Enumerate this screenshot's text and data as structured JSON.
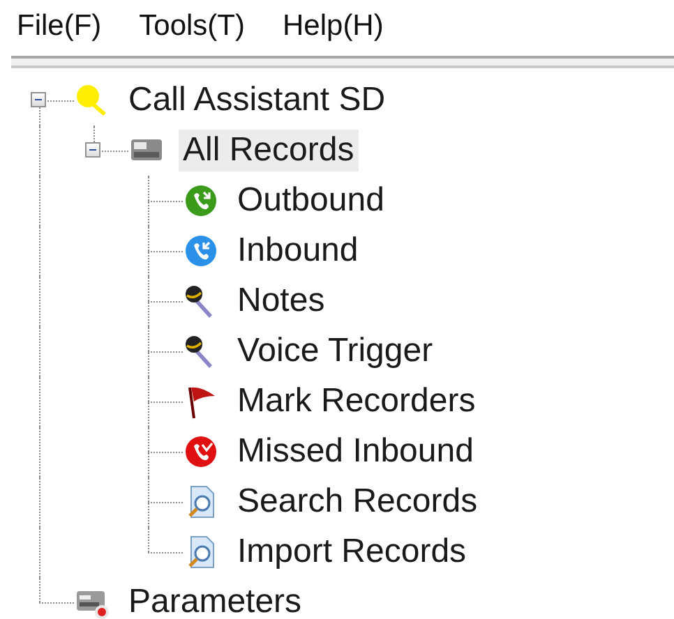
{
  "menu": [
    {
      "label": "File(F)"
    },
    {
      "label": "Tools(T)"
    },
    {
      "label": "Help(H)"
    }
  ],
  "tree": [
    {
      "label": "Call Assistant SD",
      "kind": "key",
      "expanded": true,
      "selected": false,
      "children": [
        {
          "label": "All Records",
          "kind": "drive",
          "expanded": true,
          "selected": true,
          "children": [
            {
              "label": "Outbound",
              "kind": "call-out",
              "selected": false
            },
            {
              "label": "Inbound",
              "kind": "call-in",
              "selected": false
            },
            {
              "label": "Notes",
              "kind": "mic",
              "selected": false
            },
            {
              "label": "Voice Trigger",
              "kind": "mic",
              "selected": false
            },
            {
              "label": "Mark Recorders",
              "kind": "flag",
              "selected": false
            },
            {
              "label": "Missed Inbound",
              "kind": "call-missed",
              "selected": false
            },
            {
              "label": "Search Records",
              "kind": "search-doc",
              "selected": false
            },
            {
              "label": "Import Records",
              "kind": "search-doc",
              "selected": false
            }
          ]
        }
      ]
    },
    {
      "label": "Parameters",
      "kind": "device",
      "selected": false
    }
  ]
}
